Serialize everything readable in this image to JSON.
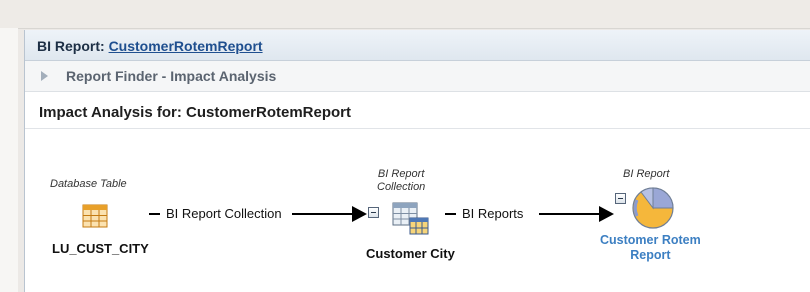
{
  "header": {
    "label": "BI Report:",
    "link": "CustomerRotemReport"
  },
  "breadcrumb": {
    "text": "Report Finder - Impact Analysis"
  },
  "section": {
    "title": "Impact Analysis for: CustomerRotemReport"
  },
  "diagram": {
    "nodes": [
      {
        "caption": "Database Table",
        "name": "LU_CUST_CITY",
        "icon": "database-table-icon"
      },
      {
        "caption_line1": "BI Report",
        "caption_line2": "Collection",
        "name": "Customer City",
        "icon": "report-collection-icon"
      },
      {
        "caption": "BI Report",
        "name_line1": "Customer Rotem",
        "name_line2": "Report",
        "icon": "pie-chart-icon"
      }
    ],
    "connectors": [
      {
        "label": "BI Report Collection"
      },
      {
        "label": "BI Reports"
      }
    ]
  },
  "colors": {
    "link": "#1f4f8f",
    "node_link": "#3c7fc2",
    "table_icon": "#e8a02a"
  }
}
